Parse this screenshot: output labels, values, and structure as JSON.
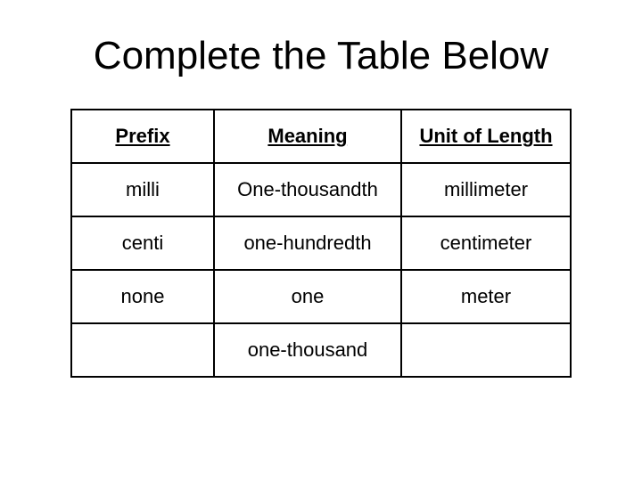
{
  "title": "Complete the Table Below",
  "headers": {
    "col1": "Prefix",
    "col2": "Meaning",
    "col3": "Unit of Length"
  },
  "rows": [
    {
      "prefix": "milli",
      "meaning": "One-thousandth",
      "unit": "millimeter"
    },
    {
      "prefix": "centi",
      "meaning": "one-hundredth",
      "unit": "centimeter"
    },
    {
      "prefix": "none",
      "meaning": "one",
      "unit": "meter"
    },
    {
      "prefix": "",
      "meaning": "one-thousand",
      "unit": ""
    }
  ],
  "chart_data": {
    "type": "table",
    "title": "Complete the Table Below",
    "columns": [
      "Prefix",
      "Meaning",
      "Unit of Length"
    ],
    "rows": [
      [
        "milli",
        "One-thousandth",
        "millimeter"
      ],
      [
        "centi",
        "one-hundredth",
        "centimeter"
      ],
      [
        "none",
        "one",
        "meter"
      ],
      [
        "",
        "one-thousand",
        ""
      ]
    ]
  }
}
